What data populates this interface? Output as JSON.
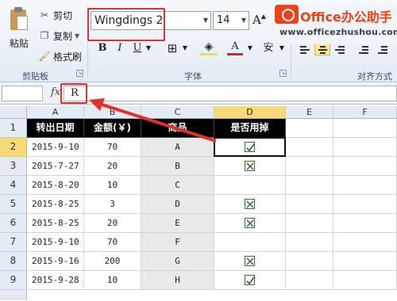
{
  "ribbon": {
    "clipboard": {
      "paste_label": "粘贴",
      "cut_label": "剪切",
      "copy_label": "复制",
      "format_painter_label": "格式刷",
      "group_label": "剪贴板"
    },
    "font": {
      "font_name": "Wingdings 2",
      "font_size": "14",
      "bold_label": "B",
      "italic_label": "I",
      "underline_label": "U",
      "group_label": "字体"
    },
    "alignment": {
      "group_label": "对齐方式"
    }
  },
  "watermark": {
    "title": "Office办公助手",
    "url": "www.officezhushou.com"
  },
  "formula_bar": {
    "fx_label": "fx",
    "value": "R"
  },
  "sheet": {
    "columns": [
      "A",
      "B",
      "C",
      "D",
      "E",
      "F"
    ],
    "selected_column": "D",
    "selected_row": "2",
    "headers": [
      "转出日期",
      "金额(￥)",
      "商品",
      "是否用掉"
    ],
    "rows": [
      {
        "num": "2",
        "date": "2015-9-10",
        "amount": "70",
        "item": "A",
        "used": "checked"
      },
      {
        "num": "3",
        "date": "2015-7-27",
        "amount": "20",
        "item": "B",
        "used": "crossed"
      },
      {
        "num": "4",
        "date": "2015-8-20",
        "amount": "10",
        "item": "C",
        "used": "none"
      },
      {
        "num": "5",
        "date": "2015-8-25",
        "amount": "3",
        "item": "D",
        "used": "crossed"
      },
      {
        "num": "6",
        "date": "2015-8-25",
        "amount": "20",
        "item": "E",
        "used": "crossed"
      },
      {
        "num": "7",
        "date": "2015-9-10",
        "amount": "70",
        "item": "F",
        "used": "none"
      },
      {
        "num": "8",
        "date": "2015-9-16",
        "amount": "200",
        "item": "G",
        "used": "crossed"
      },
      {
        "num": "9",
        "date": "2015-9-28",
        "amount": "10",
        "item": "H",
        "used": "checked"
      }
    ],
    "header_row_num": "1",
    "colors": {
      "header_bg": "#000000",
      "selection": "#f7d97a",
      "annotation": "#e0312b"
    }
  }
}
